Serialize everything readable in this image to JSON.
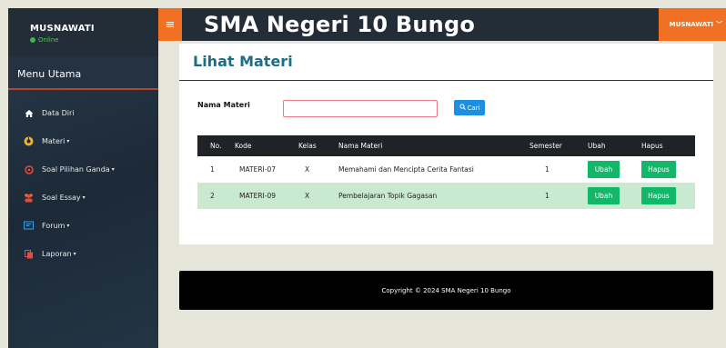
{
  "sidebar": {
    "user": {
      "name": "MUSNAWATI",
      "status": "Online"
    },
    "menu_title": "Menu Utama",
    "items": [
      {
        "label": "Data Diri",
        "icon": "home-icon",
        "caret": ""
      },
      {
        "label": "Materi",
        "icon": "dashboard-icon",
        "caret": "▾"
      },
      {
        "label": "Soal Pilihan Ganda",
        "icon": "circle-icon",
        "caret": "▾"
      },
      {
        "label": "Soal Essay",
        "icon": "users-icon",
        "caret": "▾"
      },
      {
        "label": "Forum",
        "icon": "forum-icon",
        "caret": "▾"
      },
      {
        "label": "Laporan",
        "icon": "copy-icon",
        "caret": "▾"
      }
    ]
  },
  "header": {
    "menu_icon": "hamburger-icon",
    "title": "SMA Negeri 10 Bungo",
    "user_menu": "MUSNAWATI"
  },
  "main": {
    "page_title": "Lihat Materi",
    "search": {
      "label": "Nama Materi",
      "value": "",
      "placeholder": "",
      "button_label": "Cari",
      "button_icon": "search-icon"
    },
    "table": {
      "headers": [
        "No.",
        "Kode",
        "Kelas",
        "Nama Materi",
        "Semester",
        "Ubah",
        "Hapus"
      ],
      "rows": [
        {
          "no": "1",
          "kode": "MATERI-07",
          "kelas": "X",
          "nama": "Memahami dan Mencipta Cerita Fantasi",
          "semester": "1",
          "ubah": "Ubah",
          "hapus": "Hapus"
        },
        {
          "no": "2",
          "kode": "MATERI-09",
          "kelas": "X",
          "nama": "Pembelajaran Topik Gagasan",
          "semester": "1",
          "ubah": "Ubah",
          "hapus": "Hapus"
        }
      ]
    }
  },
  "footer": {
    "text": "Copyright © 2024 SMA Negeri 10 Bungo"
  },
  "colors": {
    "accent": "#f07024",
    "sidebar": "#1c2a38",
    "title": "#1b6e86",
    "action_button": "#12b76a",
    "search_button": "#1d8fe0",
    "striped_row": "#c9e9d0"
  }
}
